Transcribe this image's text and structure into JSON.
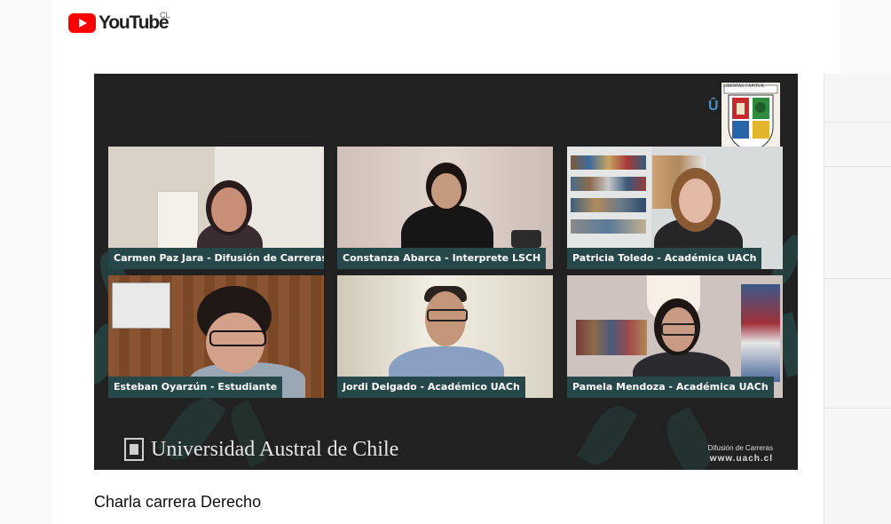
{
  "header": {
    "logo_text": "YouTube",
    "country_code": "CL"
  },
  "video": {
    "title": "Charla carrera Derecho",
    "participants": [
      {
        "label": "Carmen Paz Jara - Difusión de Carreras"
      },
      {
        "label": "Constanza Abarca - Interprete LSCH"
      },
      {
        "label": "Patricia Toledo - Académica UACh"
      },
      {
        "label": "Esteban Oyarzún - Estudiante"
      },
      {
        "label": "Jordi Delgado - Académico UACh"
      },
      {
        "label": "Pamela Mendoza - Académica UACh"
      }
    ],
    "branding": {
      "university_name": "Universidad Austral de Chile",
      "crest_motto": "LIBERTAS CAPITUR",
      "footer_department": "Difusión de Carreras",
      "footer_url": "www.uach.cl"
    }
  },
  "colors": {
    "youtube_red": "#ff0000",
    "label_bg": "#27484a",
    "video_bg": "#212121"
  }
}
